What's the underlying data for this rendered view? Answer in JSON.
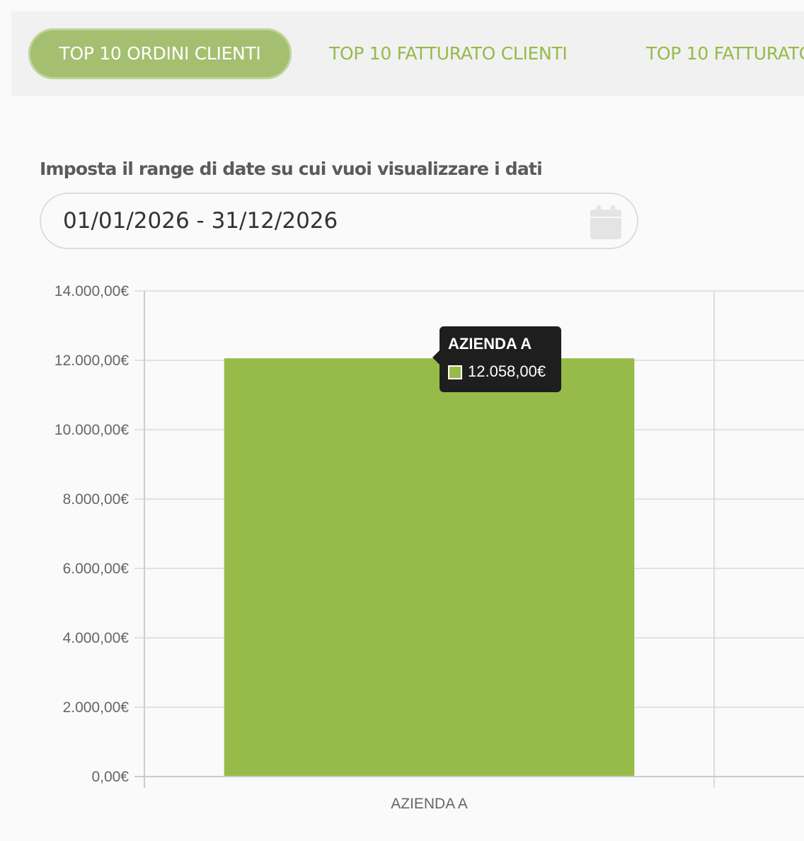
{
  "tabs": [
    {
      "label": "TOP 10 ORDINI CLIENTI",
      "active": true
    },
    {
      "label": "TOP 10 FATTURATO CLIENTI",
      "active": false
    },
    {
      "label": "TOP 10 FATTURATO",
      "active": false
    }
  ],
  "date_filter": {
    "label": "Imposta il range di date su cui vuoi visualizzare i dati",
    "value": "01/01/2026 - 31/12/2026",
    "icon": "calendar-icon"
  },
  "colors": {
    "accent": "#95bb49",
    "bar": "#96bb49",
    "tab_active_bg": "#a4bf70"
  },
  "chart_data": {
    "type": "bar",
    "categories": [
      "AZIENDA A"
    ],
    "values": [
      12058
    ],
    "ylim": [
      0,
      14000
    ],
    "yticks": [
      {
        "value": 0,
        "label": "0,00€"
      },
      {
        "value": 2000,
        "label": "2.000,00€"
      },
      {
        "value": 4000,
        "label": "4.000,00€"
      },
      {
        "value": 6000,
        "label": "6.000,00€"
      },
      {
        "value": 8000,
        "label": "8.000,00€"
      },
      {
        "value": 10000,
        "label": "10.000,00€"
      },
      {
        "value": 12000,
        "label": "12.000,00€"
      },
      {
        "value": 14000,
        "label": "14.000,00€"
      }
    ],
    "grid": true,
    "tooltip": {
      "title": "AZIENDA A",
      "value": "12.058,00€"
    }
  }
}
